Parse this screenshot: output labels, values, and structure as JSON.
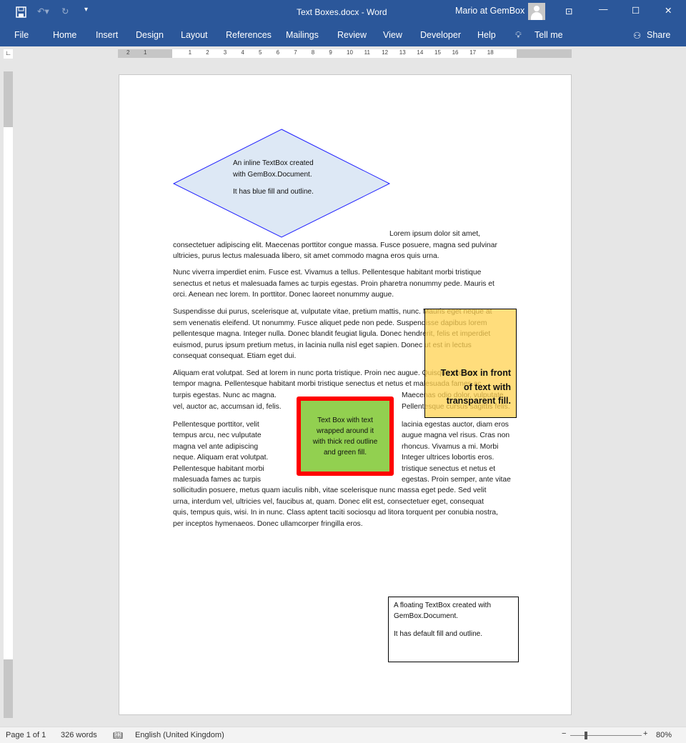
{
  "window": {
    "title": "Text Boxes.docx  -  Word",
    "user": "Mario at GemBox"
  },
  "ribbon": {
    "tabs": [
      "File",
      "Home",
      "Insert",
      "Design",
      "Layout",
      "References",
      "Mailings",
      "Review",
      "View",
      "Developer",
      "Help"
    ],
    "tell_me": "Tell me",
    "share": "Share"
  },
  "ruler": {
    "numbers": [
      "2",
      "1",
      "1",
      "2",
      "3",
      "4",
      "5",
      "6",
      "7",
      "8",
      "9",
      "10",
      "11",
      "12",
      "13",
      "14",
      "15",
      "16",
      "17",
      "18"
    ]
  },
  "document": {
    "diamond": {
      "lines": [
        "An inline TextBox created",
        "with GemBox.Document.",
        "It has blue fill and outline."
      ],
      "fill": "#dde8f5",
      "outline": "#1f1fff"
    },
    "body": [
      {
        "l": "Lorem ipsum dolor sit amet,",
        "indent": true
      },
      {
        "l": "consectetuer adipiscing elit. Maecenas porttitor congue massa. Fusce posuere, magna sed pulvinar"
      },
      {
        "l": "ultricies, purus lectus malesuada libero, sit amet commodo magna eros quis urna."
      },
      {
        "l": "Nunc viverra imperdiet enim. Fusce est. Vivamus a tellus. Pellentesque habitant morbi tristique"
      },
      {
        "l": "senectus et netus et malesuada fames ac turpis egestas. Proin pharetra nonummy pede. Mauris et"
      },
      {
        "l": "orci. Aenean nec lorem. In porttitor. Donec laoreet nonummy augue."
      },
      {
        "l": "Suspendisse dui purus, scelerisque at, vulputate vitae, pretium mattis, nunc. Mauris eget neque at"
      },
      {
        "l": "sem venenatis eleifend. Ut nonummy. Fusce aliquet pede non pede. Suspendisse dapibus lorem"
      },
      {
        "l": "pellentesque magna. Integer nulla. Donec blandit feugiat ligula. Donec hendrerit, felis et imperdiet"
      },
      {
        "l": "euismod, purus ipsum pretium metus, in lacinia nulla nisl eget sapien. Donec ut est in lectus"
      },
      {
        "l": "consequat consequat. Etiam eget dui."
      },
      {
        "l": "Aliquam erat volutpat. Sed at lorem in nunc porta tristique. Proin nec augue. Quisque aliquam"
      },
      {
        "l": "tempor magna. Pellentesque habitant morbi tristique senectus et netus et malesuada fames ac"
      },
      {
        "l": "turpis egestas. Nunc ac magna.",
        "r": "Maecenas odio dolor, vulputate"
      },
      {
        "l": "vel, auctor ac, accumsan id, felis.",
        "r": "Pellentesque cursus sagittis felis."
      },
      {
        "l": "Pellentesque porttitor, velit",
        "r": "lacinia egestas auctor, diam eros"
      },
      {
        "l": "tempus arcu, nec vulputate",
        "r": "augue magna vel risus. Cras non"
      },
      {
        "l": "magna vel ante adipiscing",
        "r": "rhoncus. Vivamus a mi. Morbi"
      },
      {
        "l": "neque. Aliquam erat volutpat.",
        "r": "Integer ultrices lobortis eros."
      },
      {
        "l": "Pellentesque habitant morbi",
        "r": "tristique senectus et netus et"
      },
      {
        "l": "malesuada fames ac turpis",
        "r": "egestas. Proin semper, ante vitae"
      },
      {
        "l": "sollicitudin posuere, metus quam iaculis nibh, vitae scelerisque nunc massa eget pede. Sed velit"
      },
      {
        "l": "urna, interdum vel, ultricies vel, faucibus at, quam. Donec elit est, consectetuer eget, consequat"
      },
      {
        "l": "quis, tempus quis, wisi. In in nunc. Class aptent taciti sociosqu ad litora torquent per conubia nostra,"
      },
      {
        "l": "per inceptos hymenaeos. Donec ullamcorper fringilla eros."
      }
    ],
    "yellow_box": {
      "lines": [
        "Text Box in front",
        "of text with",
        "transparent fill."
      ],
      "fill": "#ffd966"
    },
    "green_box": {
      "lines": [
        "Text Box with text",
        "wrapped around it",
        "with thick red outline",
        "and green fill."
      ],
      "fill": "#92d050",
      "outline": "#ff0000"
    },
    "floating_box": {
      "lines": [
        "A floating TextBox created with",
        "GemBox.Document.",
        "It has default fill and outline."
      ]
    }
  },
  "status": {
    "page": "Page 1 of 1",
    "words": "326 words",
    "language": "English (United Kingdom)",
    "zoom": "80%",
    "zoom_percent": 80
  }
}
